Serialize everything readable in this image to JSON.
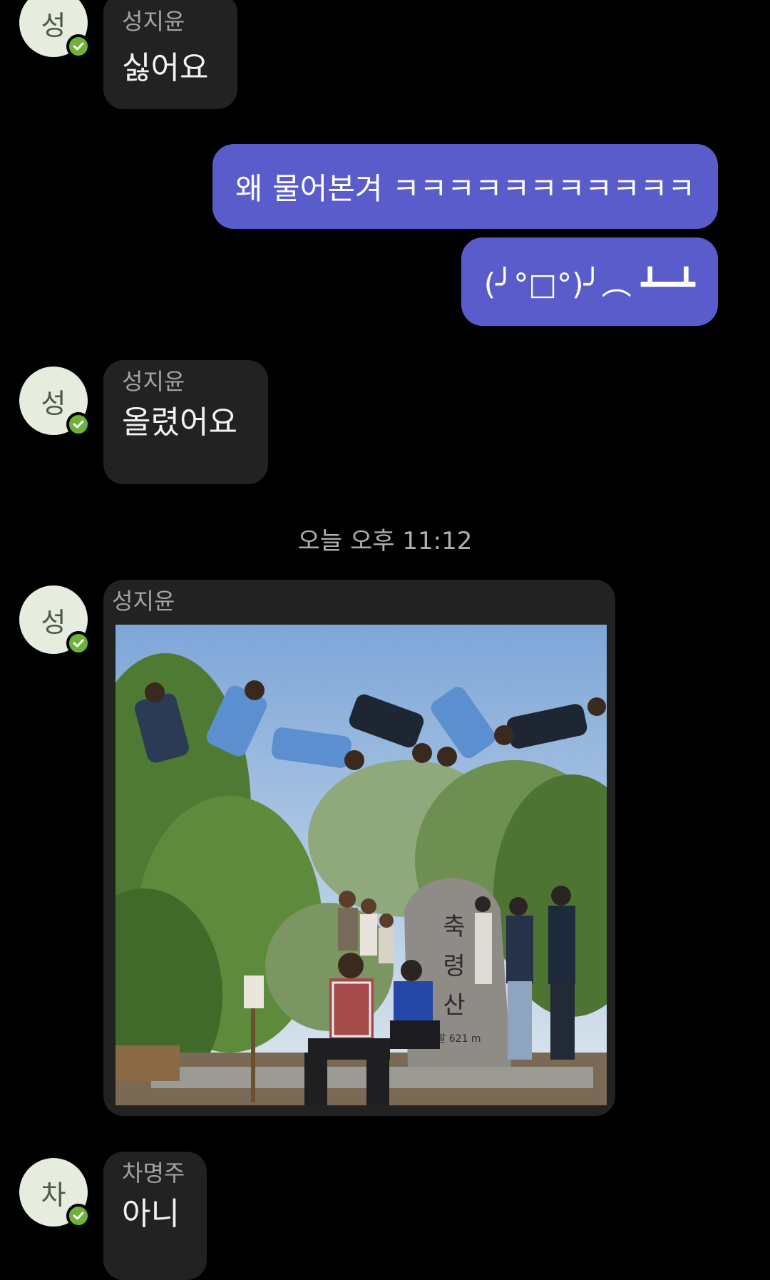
{
  "messages": [
    {
      "sender": "성지윤",
      "avatar": "성",
      "text": "싫어요"
    },
    {
      "text": "왜 물어본겨 ㅋㅋㅋㅋㅋㅋㅋㅋㅋㅋㅋ"
    },
    {
      "text": "(╯°□°)╯︵ ┻━┻"
    },
    {
      "sender": "성지윤",
      "avatar": "성",
      "text": "올렸어요"
    },
    {
      "sender": "성지윤",
      "avatar": "성",
      "image_text": [
        "축",
        "령",
        "산"
      ],
      "image_caption": "해발 621 m"
    },
    {
      "sender": "차명주",
      "avatar": "차",
      "text": "아니"
    }
  ],
  "timestamp": "오늘 오후 11:12",
  "colors": {
    "background": "#000000",
    "incoming_bubble": "#222222",
    "outgoing_bubble": "#5b5ccb",
    "verified_badge": "#6fb23a"
  },
  "icons": {
    "badge": "check-circle-icon"
  }
}
